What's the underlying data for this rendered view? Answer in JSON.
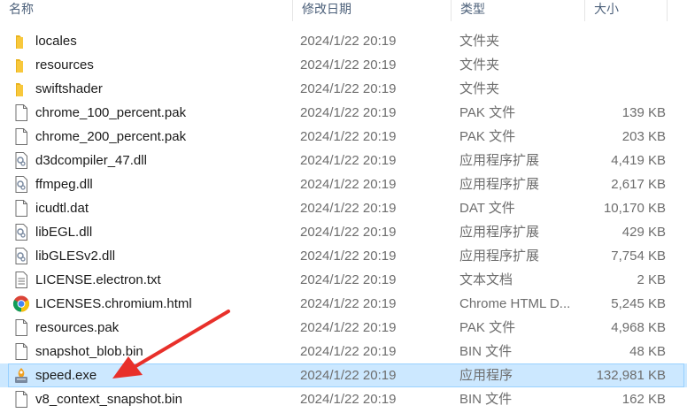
{
  "header": {
    "name": "名称",
    "date": "修改日期",
    "type": "类型",
    "size": "大小"
  },
  "files": [
    {
      "name": "locales",
      "date": "2024/1/22 20:19",
      "type": "文件夹",
      "size": "",
      "icon": "folder"
    },
    {
      "name": "resources",
      "date": "2024/1/22 20:19",
      "type": "文件夹",
      "size": "",
      "icon": "folder"
    },
    {
      "name": "swiftshader",
      "date": "2024/1/22 20:19",
      "type": "文件夹",
      "size": "",
      "icon": "folder"
    },
    {
      "name": "chrome_100_percent.pak",
      "date": "2024/1/22 20:19",
      "type": "PAK 文件",
      "size": "139 KB",
      "icon": "file"
    },
    {
      "name": "chrome_200_percent.pak",
      "date": "2024/1/22 20:19",
      "type": "PAK 文件",
      "size": "203 KB",
      "icon": "file"
    },
    {
      "name": "d3dcompiler_47.dll",
      "date": "2024/1/22 20:19",
      "type": "应用程序扩展",
      "size": "4,419 KB",
      "icon": "dll"
    },
    {
      "name": "ffmpeg.dll",
      "date": "2024/1/22 20:19",
      "type": "应用程序扩展",
      "size": "2,617 KB",
      "icon": "dll"
    },
    {
      "name": "icudtl.dat",
      "date": "2024/1/22 20:19",
      "type": "DAT 文件",
      "size": "10,170 KB",
      "icon": "file"
    },
    {
      "name": "libEGL.dll",
      "date": "2024/1/22 20:19",
      "type": "应用程序扩展",
      "size": "429 KB",
      "icon": "dll"
    },
    {
      "name": "libGLESv2.dll",
      "date": "2024/1/22 20:19",
      "type": "应用程序扩展",
      "size": "7,754 KB",
      "icon": "dll"
    },
    {
      "name": "LICENSE.electron.txt",
      "date": "2024/1/22 20:19",
      "type": "文本文档",
      "size": "2 KB",
      "icon": "text"
    },
    {
      "name": "LICENSES.chromium.html",
      "date": "2024/1/22 20:19",
      "type": "Chrome HTML D...",
      "size": "5,245 KB",
      "icon": "chrome"
    },
    {
      "name": "resources.pak",
      "date": "2024/1/22 20:19",
      "type": "PAK 文件",
      "size": "4,968 KB",
      "icon": "file"
    },
    {
      "name": "snapshot_blob.bin",
      "date": "2024/1/22 20:19",
      "type": "BIN 文件",
      "size": "48 KB",
      "icon": "file"
    },
    {
      "name": "speed.exe",
      "date": "2024/1/22 20:19",
      "type": "应用程序",
      "size": "132,981 KB",
      "icon": "exe",
      "selected": true
    },
    {
      "name": "v8_context_snapshot.bin",
      "date": "2024/1/22 20:19",
      "type": "BIN 文件",
      "size": "162 KB",
      "icon": "file"
    }
  ],
  "colors": {
    "selection": "#cce8ff",
    "selection_border": "#99d1ff",
    "folder": "#f8c83c",
    "arrow": "#e8302a"
  }
}
